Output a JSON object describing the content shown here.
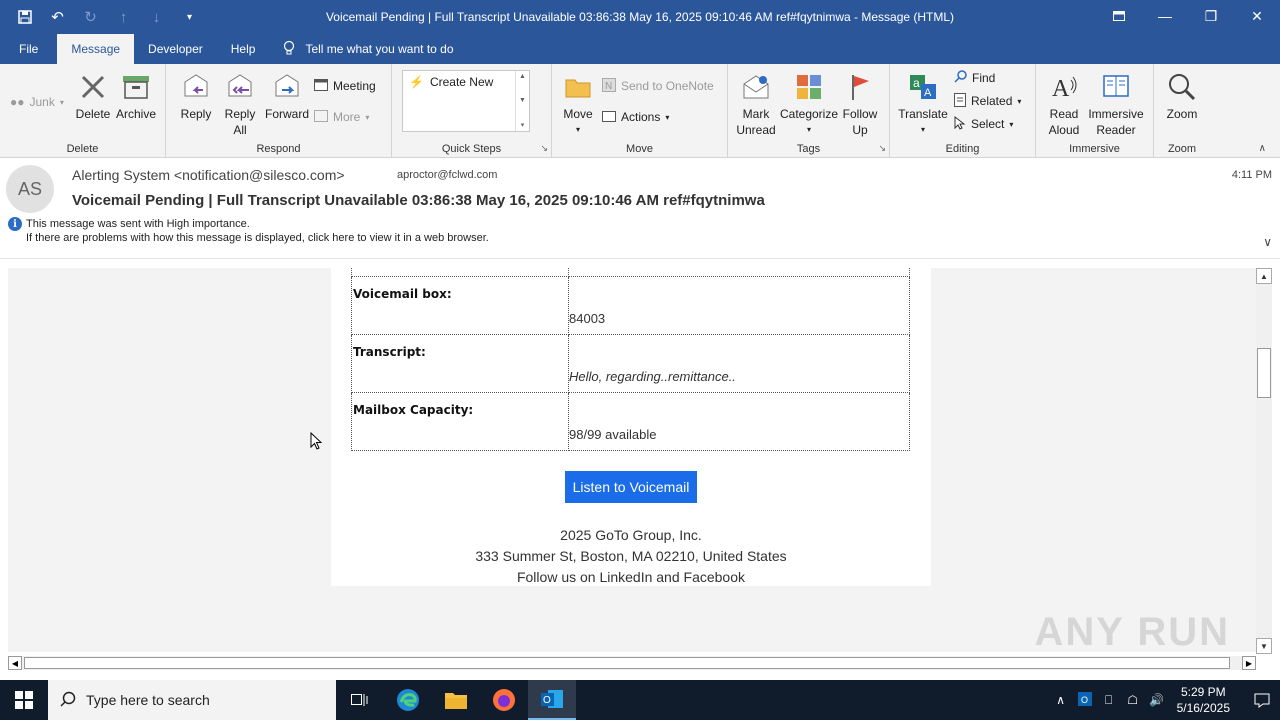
{
  "window": {
    "title": "Voicemail Pending | Full Transcript Unavailable 03:86:38 May 16, 2025 09:10:46 AM ref#fqytnimwa  -  Message (HTML)"
  },
  "ribbon_tabs": [
    "File",
    "Message",
    "Developer",
    "Help"
  ],
  "active_tab": "Message",
  "tell_me": "Tell me what you want to do",
  "ribbon": {
    "delete": {
      "label": "Delete",
      "junk": "Junk",
      "delete_btn": "Delete",
      "archive": "Archive"
    },
    "respond": {
      "label": "Respond",
      "reply": "Reply",
      "reply_all_1": "Reply",
      "reply_all_2": "All",
      "forward": "Forward",
      "meeting": "Meeting",
      "more": "More"
    },
    "quick_steps": {
      "label": "Quick Steps",
      "create_new": "Create New"
    },
    "move": {
      "label": "Move",
      "move_btn": "Move",
      "send_onenote": "Send to OneNote",
      "actions": "Actions"
    },
    "tags": {
      "label": "Tags",
      "mark_unread_1": "Mark",
      "mark_unread_2": "Unread",
      "categorize": "Categorize",
      "follow_up_1": "Follow",
      "follow_up_2": "Up"
    },
    "editing": {
      "label": "Editing",
      "translate": "Translate",
      "find": "Find",
      "related": "Related",
      "select": "Select"
    },
    "immersive": {
      "label": "Immersive",
      "read_aloud_1": "Read",
      "read_aloud_2": "Aloud",
      "immersive_reader_1": "Immersive",
      "immersive_reader_2": "Reader"
    },
    "zoom": {
      "label": "Zoom",
      "zoom_btn": "Zoom"
    }
  },
  "message": {
    "avatar_initials": "AS",
    "sender": "Alerting System <notification@silesco.com>",
    "recipient": "aproctor@fclwd.com",
    "time": "4:11 PM",
    "subject": "Voicemail Pending | Full Transcript Unavailable 03:86:38 May 16, 2025 09:10:46 AM ref#fqytnimwa",
    "importance": "This message was sent with High importance.",
    "web_view": "If there are problems with how this message is displayed, click here to view it in a web browser."
  },
  "body": {
    "rows": [
      {
        "key": "Voicemail box:",
        "value": "84003",
        "italic": false
      },
      {
        "key": "Transcript:",
        "value": "Hello, regarding..remittance..",
        "italic": true
      },
      {
        "key": "Mailbox Capacity:",
        "value": "98/99 available",
        "italic": false
      }
    ],
    "listen_button": "Listen to Voicemail",
    "footer": [
      "2025 GoTo Group, Inc.",
      "333 Summer St, Boston, MA 02210, United States",
      "Follow us on LinkedIn and Facebook"
    ]
  },
  "watermark": "ANY RUN",
  "taskbar": {
    "search_placeholder": "Type here to search",
    "time": "5:29 PM",
    "date": "5/16/2025"
  },
  "colors": {
    "title_bar": "#2b579a",
    "listen_button": "#1a6ce8",
    "taskbar": "#101c2c"
  }
}
